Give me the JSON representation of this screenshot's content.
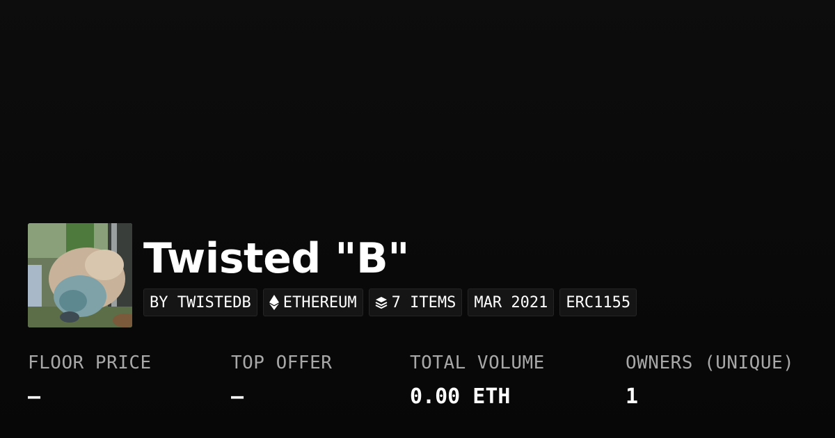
{
  "collection": {
    "name": "Twisted \"B\"",
    "avatar_icon": "collection-avatar-image"
  },
  "tags": {
    "creator": "BY TWISTEDB",
    "chain": "ETHEREUM",
    "chain_icon": "ethereum-icon",
    "items": "7 ITEMS",
    "items_icon": "layers-icon",
    "created": "MAR 2021",
    "standard": "ERC1155"
  },
  "stats": {
    "floor_price": {
      "label": "FLOOR PRICE",
      "value": "–"
    },
    "top_offer": {
      "label": "TOP OFFER",
      "value": "–"
    },
    "total_volume": {
      "label": "TOTAL VOLUME",
      "value": "0.00 ETH"
    },
    "owners": {
      "label": "OWNERS (UNIQUE)",
      "value": "1"
    }
  },
  "colors": {
    "background": "#0a0a0a",
    "text": "#ffffff",
    "muted_text": "#a8a8a8",
    "tag_background": "#151515"
  }
}
